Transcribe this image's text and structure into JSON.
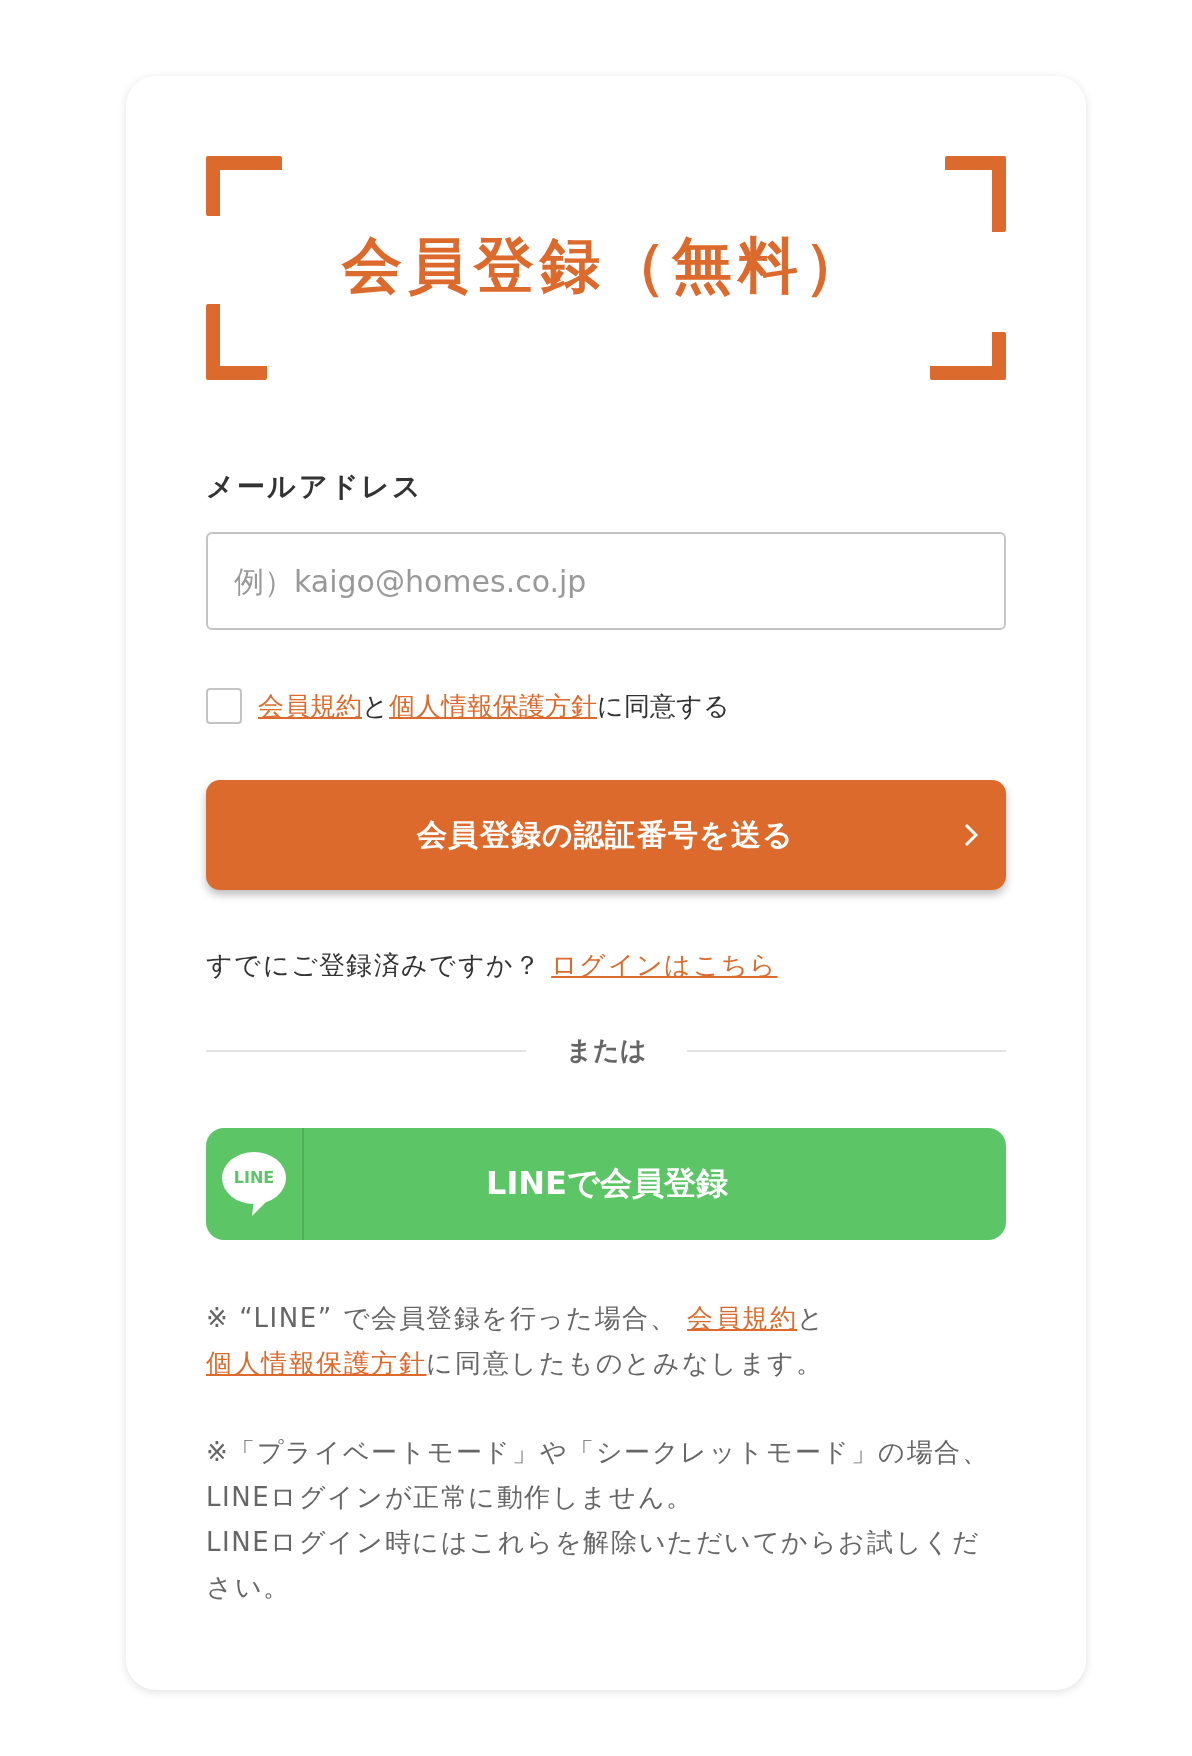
{
  "title": "会員登録（無料）",
  "email": {
    "label": "メールアドレス",
    "placeholder": "例）kaigo@homes.co.jp"
  },
  "agreement": {
    "checked": false,
    "segments": [
      {
        "kind": "link",
        "text": "会員規約"
      },
      {
        "kind": "text",
        "text": "と"
      },
      {
        "kind": "link",
        "text": "個人情報保護方針"
      },
      {
        "kind": "text",
        "text": "に同意する"
      }
    ]
  },
  "submit_button": {
    "label": "会員登録の認証番号を送る"
  },
  "login_prompt": {
    "segments": [
      {
        "kind": "text",
        "text": "すでにご登録済みですか？ "
      },
      {
        "kind": "link",
        "text": "ログインはこちら"
      }
    ]
  },
  "divider": {
    "label": "または"
  },
  "line_button": {
    "logo_text": "LINE",
    "label": "LINEで会員登録"
  },
  "notes": [
    {
      "paragraphs": [
        [
          {
            "kind": "text",
            "text": "※ “LINE” で会員登録を行った場合、 "
          },
          {
            "kind": "link",
            "text": "会員規約"
          },
          {
            "kind": "text",
            "text": "と"
          },
          {
            "kind": "link",
            "text": "個人情報保護方針"
          },
          {
            "kind": "text",
            "text": "に同意したものとみなします。"
          }
        ]
      ]
    },
    {
      "paragraphs": [
        [
          {
            "kind": "text",
            "text": "※「プライベートモード」や「シークレットモード」の場合、LINEログインが正常に動作しません。"
          }
        ],
        [
          {
            "kind": "text",
            "text": "LINEログイン時にはこれらを解除いただいてからお試しください。"
          }
        ]
      ]
    }
  ]
}
